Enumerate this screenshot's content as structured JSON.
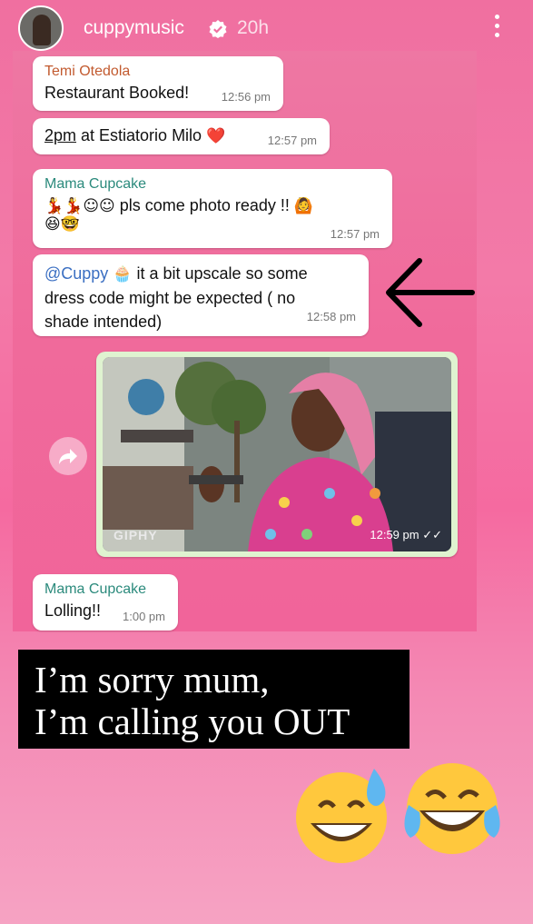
{
  "story_header": {
    "username": "cuppymusic",
    "time_ago": "20h",
    "icons": [
      "avatar",
      "verified-badge-icon",
      "more-options-icon"
    ]
  },
  "messages": [
    {
      "sender": "Temi Otedola",
      "text": "Restaurant Booked!",
      "time": "12:56 pm"
    },
    {
      "text_underlined": "2pm",
      "text": " at Estiatorio Milo",
      "emoji": "❤️",
      "time": "12:57 pm"
    },
    {
      "sender": "Mama Cupcake",
      "emoji_prefix": "💃💃☺☺",
      "text": " pls come photo ready !!",
      "emoji_suffix": "🙆",
      "emoji_line2": "😆🤓",
      "time": "12:57 pm"
    },
    {
      "mention": "@Cuppy",
      "emoji": "🧁",
      "text_line1": " it a bit upscale so some",
      "text_line2": "dress code might be expected ( no",
      "text_line3": "shade intended)",
      "time": "12:58 pm"
    },
    {
      "type": "gif",
      "watermark": "GIPHY",
      "time": "12:59 pm",
      "read_ticks": "✓✓"
    },
    {
      "sender": "Mama Cupcake",
      "text": "Lolling!!",
      "time": "1:00 pm"
    }
  ],
  "caption": {
    "line1": "I’m sorry mum,",
    "line2": "I’m calling you OUT"
  },
  "stickers": [
    "grinning-face-with-sweat-emoji",
    "face-with-tears-of-joy-emoji"
  ],
  "colors": {
    "background": "#f06fa0",
    "sender_orange": "#c25a2f",
    "sender_teal": "#2b8a7c",
    "mention_blue": "#3b6fc2",
    "gif_bubble": "#dff3d0"
  }
}
